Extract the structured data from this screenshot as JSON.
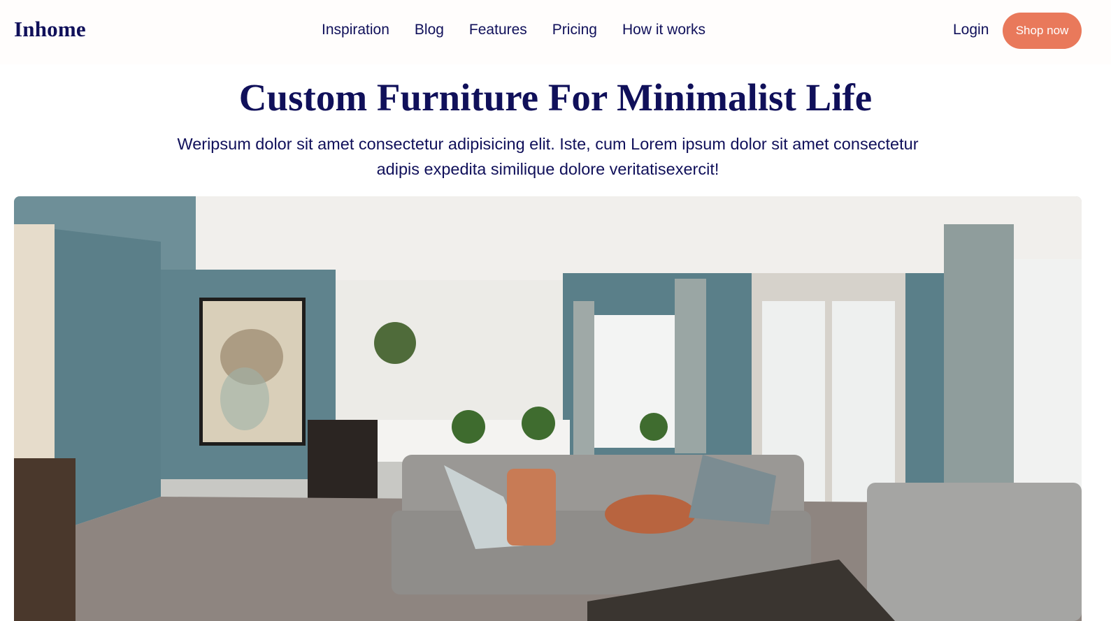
{
  "header": {
    "logo": "Inhome",
    "nav": [
      {
        "label": "Inspiration"
      },
      {
        "label": "Blog"
      },
      {
        "label": "Features"
      },
      {
        "label": "Pricing"
      },
      {
        "label": "How it works"
      }
    ],
    "login_label": "Login",
    "cta_label": "Shop now"
  },
  "hero": {
    "title": "Custom Furniture For Minimalist Life",
    "subtitle": "Weripsum dolor sit amet consectetur adipisicing elit. Iste, cum Lorem ipsum dolor sit amet consectetur adipis expedita similique dolore veritatisexercit!"
  },
  "colors": {
    "brand_navy": "#10105a",
    "accent_orange": "#e9795b",
    "wall_teal": "#587f8a"
  }
}
